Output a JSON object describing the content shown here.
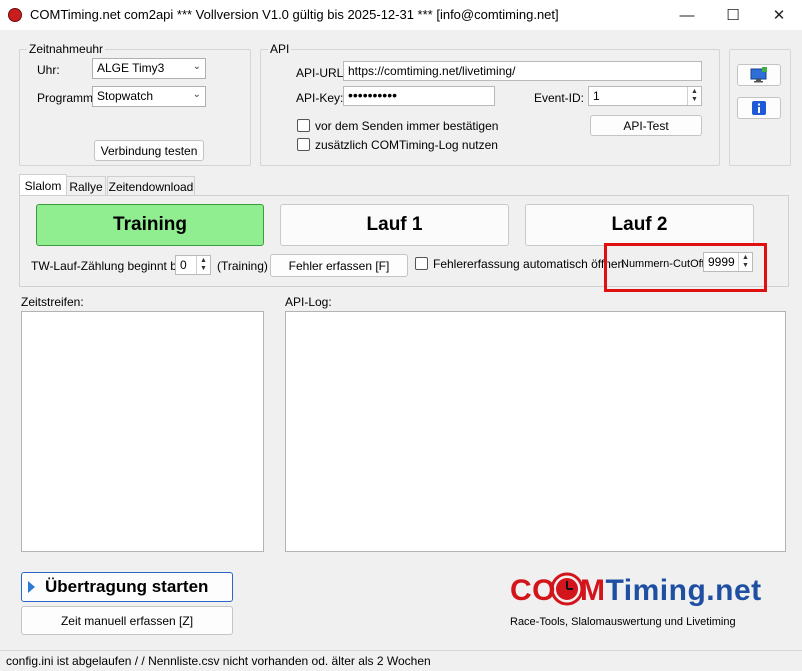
{
  "window": {
    "title": "COMTiming.net com2api *** Vollversion V1.0 gültig bis 2025-12-31 *** [info@comtiming.net]",
    "minimize_glyph": "—",
    "maximize_glyph": "☐",
    "close_glyph": "✕"
  },
  "zeitnahme": {
    "group_label": "Zeitnahmeuhr",
    "uhr_label": "Uhr:",
    "uhr_value": "ALGE Timy3",
    "programm_label": "Programm:",
    "programm_value": "Stopwatch",
    "test_button": "Verbindung testen"
  },
  "api": {
    "group_label": "API",
    "url_label": "API-URL:",
    "url_value": "https://comtiming.net/livetiming/",
    "key_label": "API-Key:",
    "key_value": "••••••••••",
    "event_label": "Event-ID:",
    "event_value": "1",
    "confirm_label": "vor dem Senden immer bestätigen",
    "log_label": "zusätzlich COMTiming-Log nutzen",
    "test_button": "API-Test"
  },
  "side_icons": {
    "monitor_icon": "monitor-icon",
    "info_icon": "info-icon"
  },
  "tabs": [
    {
      "label": "Slalom",
      "active": true
    },
    {
      "label": "Rallye",
      "active": false
    },
    {
      "label": "Zeitendownload",
      "active": false
    }
  ],
  "slalom": {
    "training_button": "Training",
    "lauf1_button": "Lauf 1",
    "lauf2_button": "Lauf 2",
    "tw_label": "TW-Lauf-Zählung beginnt bei:",
    "tw_value": "0",
    "tw_suffix": "(Training)",
    "fehler_button": "Fehler erfassen [F]",
    "fehler_auto_label": "Fehlererfassung automatisch öffnen",
    "cutoff_label": "Nummern-CutOff:",
    "cutoff_value": "9999"
  },
  "zeitstreifen_label": "Zeitstreifen:",
  "apilog_label": "API-Log:",
  "start_button": "Übertragung starten",
  "manual_button": "Zeit manuell erfassen [Z]",
  "logo": {
    "part1": "CO",
    "part2": "M",
    "part3": "Timing.net",
    "tagline": "Race-Tools, Slalomauswertung und Livetiming"
  },
  "status_text": "config.ini ist abgelaufen /  / Nennliste.csv  nicht vorhanden od. älter als 2 Wochen",
  "colors": {
    "training_bg": "#90ee90",
    "highlight_red": "#e01010",
    "logo_red": "#d3151b",
    "logo_blue": "#1e4fa3"
  }
}
